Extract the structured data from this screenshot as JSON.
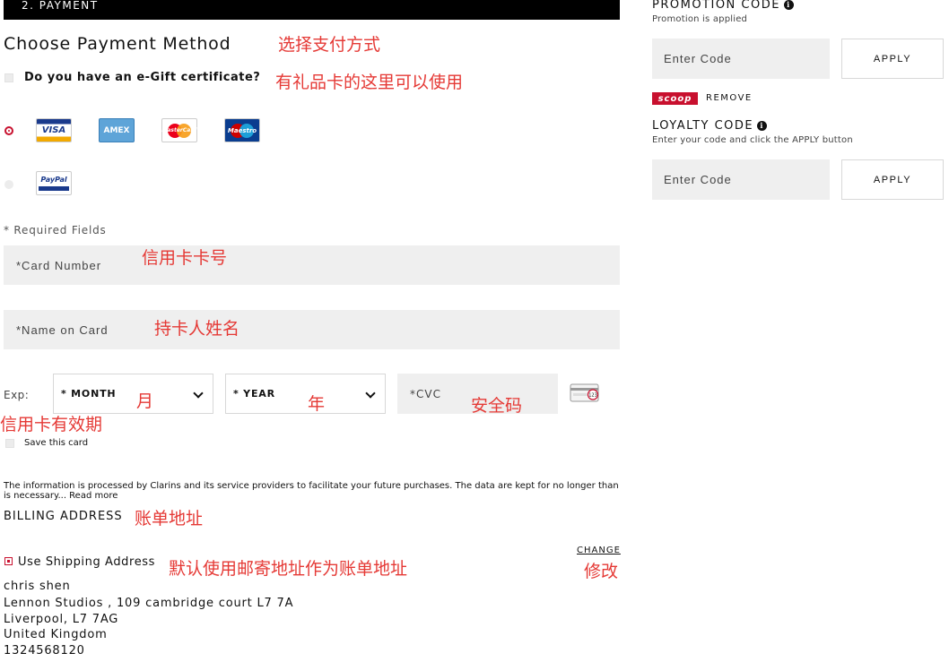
{
  "step_bar": {
    "label": "2. PAYMENT"
  },
  "payment": {
    "title": "Choose Payment Method",
    "egift_label": "Do you have an e-Gift certificate?",
    "methods": [
      {
        "name": "card",
        "selected": true,
        "cards": [
          "VISA",
          "AMEX",
          "MasterCard",
          "Maestro"
        ]
      },
      {
        "name": "paypal",
        "selected": false,
        "label": "PayPal"
      }
    ],
    "required_note": "* Required Fields",
    "card_number_placeholder": "*Card Number",
    "name_on_card_placeholder": "*Name on Card",
    "exp_label": "Exp:",
    "month_label": "* MONTH",
    "year_label": "* YEAR",
    "cvc_label": "*CVC",
    "cvc_icon_text": "123",
    "save_card_label": "Save this card",
    "disclaimer": "The information is processed by Clarins and its service providers to facilitate your future purchases. The data are kept for no longer than is necessary... Read more"
  },
  "billing": {
    "title": "BILLING ADDRESS",
    "change_label": "CHANGE",
    "use_shipping_label": "Use Shipping Address",
    "address_lines": [
      "chris shen",
      "Lennon Studios , 109 cambridge court L7 7A",
      "Liverpool, L7 7AG",
      "United Kingdom",
      "1324568120"
    ]
  },
  "sidebar": {
    "promotion": {
      "title": "PROMOTION CODE",
      "subtitle": "Promotion is applied",
      "placeholder": "Enter Code",
      "apply_label": "APPLY",
      "badge": "scoop",
      "remove_label": "REMOVE"
    },
    "loyalty": {
      "title": "LOYALTY CODE",
      "subtitle": "Enter your code and click the APPLY button",
      "placeholder": "Enter Code",
      "apply_label": "APPLY"
    }
  },
  "annotations": {
    "payment_method": "选择支付方式",
    "gift_card": "有礼品卡的这里可以使用",
    "card_number": "信用卡卡号",
    "cardholder": "持卡人姓名",
    "month": "月",
    "year": "年",
    "cvc": "安全码",
    "expiry": "信用卡有效期",
    "billing": "账单地址",
    "use_shipping": "默认使用邮寄地址作为账单地址",
    "change": "修改"
  },
  "colors": {
    "accent": "#c8102e",
    "field_bg": "#efefef",
    "annotation": "#e53935",
    "step_bar": "#000000"
  }
}
